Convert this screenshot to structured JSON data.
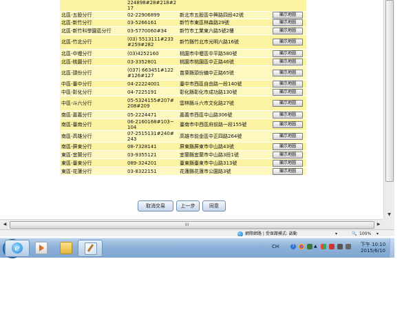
{
  "branches": {
    "top_fragment": "224898#28#218#217",
    "rows": [
      {
        "name": "北區-五股分行",
        "phone": "02-22906899",
        "address": "新北市五股區中興路四段42號",
        "button": "顯示地圖"
      },
      {
        "name": "北區-新竹分行",
        "phone": "03-5266161",
        "address": "新竹市東區林森路29號",
        "button": "顯示地圖"
      },
      {
        "name": "北區-新竹科學園區分行",
        "phone": "03-5770060#34",
        "address": "新竹市工業東六路5號2樓",
        "button": "顯示地圖"
      },
      {
        "name": "北區-竹北分行",
        "phone": "(03) 5513111#233#259#282",
        "address": "新竹縣竹北市光明六路16號",
        "button": "顯示地圖"
      },
      {
        "name": "北區-中壢分行",
        "phone": "(03)4252160",
        "address": "桃園市中壢區中平路580號",
        "button": "顯示地圖"
      },
      {
        "name": "北區-桃園分行",
        "phone": "03-3352801",
        "address": "桃園市桃園區中正路46號",
        "button": "顯示地圖"
      },
      {
        "name": "北區-頭份分行",
        "phone": "(037) 663451#122#126#127",
        "address": "苗栗縣頭份鎮中正路65號",
        "button": "顯示地圖"
      },
      {
        "name": "中區-臺中分行",
        "phone": "04-22224001",
        "address": "臺中市西區自由路一段140號",
        "button": "顯示地圖"
      },
      {
        "name": "中區-彰化分行",
        "phone": "04-7225191",
        "address": "彰化縣彰化市成功路130號",
        "button": "顯示地圖"
      },
      {
        "name": "中區-斗六分行",
        "phone": "05-5324155#207#208#209",
        "address": "雲林縣斗六市文化路27號",
        "button": "顯示地圖"
      },
      {
        "name": "南區-嘉義分行",
        "phone": "05-2224471",
        "address": "嘉義市西區中山路306號",
        "button": "顯示地圖"
      },
      {
        "name": "南區-臺南分行",
        "phone": "06-2160168#103~104",
        "address": "臺南市中西區府前路一段155號",
        "button": "顯示地圖"
      },
      {
        "name": "南區-高雄分行",
        "phone": "07-2515131#240#243",
        "address": "高雄市前金區中正四路264號",
        "button": "顯示地圖"
      },
      {
        "name": "南區-屏東分行",
        "phone": "08-7328141",
        "address": "屏東縣屏東市中山路43號",
        "button": "顯示地圖"
      },
      {
        "name": "東區-宜蘭分行",
        "phone": "03-9355121",
        "address": "宜蘭縣宜蘭市中山路3段1號",
        "button": "顯示地圖"
      },
      {
        "name": "東區-臺東分行",
        "phone": "089-324201",
        "address": "臺東縣臺東市中山路313號",
        "button": "顯示地圖"
      },
      {
        "name": "東區-花蓮分行",
        "phone": "03-8322151",
        "address": "花蓮縣花蓮市公園路3號",
        "button": "顯示地圖"
      }
    ]
  },
  "actions": {
    "cancel": "取消交易",
    "back": "上一步",
    "agree": "同意"
  },
  "scrollbar": {
    "grip": "III",
    "down_arrow": "▼",
    "left_arrow": "◀",
    "right_arrow": "▶"
  },
  "statusbar": {
    "zone_text": "網際網路 | 受保護模式: 啟動",
    "zoom": "100%",
    "zoom_arrow": "▾",
    "zoom_caret": "▾"
  },
  "taskbar": {
    "ie_glyph": "e",
    "tray_lang": "CH",
    "tray_help_glyph": "?",
    "tray_chevron": "▲",
    "time": "下午 10:10",
    "date": "2015/6/10"
  }
}
